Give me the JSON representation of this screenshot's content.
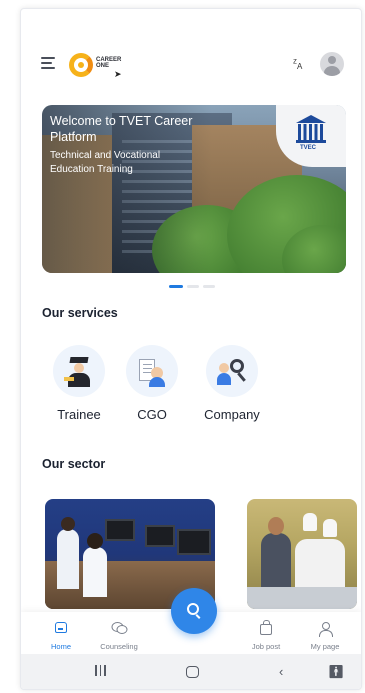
{
  "header": {
    "logo_text": "CAREER ONE",
    "translate_icon": "translate-icon",
    "avatar_icon": "user-avatar-icon"
  },
  "banner": {
    "title": "Welcome to TVET Career Platform",
    "subtitle": "Technical and Vocational Education Training",
    "badge_label": "TVEC",
    "carousel_pages": 3,
    "carousel_active": 1
  },
  "services": {
    "title": "Our services",
    "items": [
      {
        "label": "Trainee",
        "icon": "graduate-icon"
      },
      {
        "label": "CGO",
        "icon": "document-person-icon"
      },
      {
        "label": "Company",
        "icon": "search-people-icon"
      }
    ]
  },
  "sector": {
    "title": "Our sector",
    "cards": [
      {
        "image": "computer-lab-photo"
      },
      {
        "image": "chef-training-photo"
      }
    ]
  },
  "bottom_nav": {
    "items": [
      {
        "label": "Home",
        "icon": "home-icon",
        "active": true
      },
      {
        "label": "Counseling",
        "icon": "chat-icon",
        "active": false
      },
      {
        "label": "Job post",
        "icon": "briefcase-icon",
        "active": false
      },
      {
        "label": "My page",
        "icon": "user-icon",
        "active": false
      }
    ],
    "fab_icon": "search-icon"
  },
  "system_nav": {
    "buttons": [
      "recent-apps-icon",
      "home-icon",
      "back-icon",
      "accessibility-icon"
    ]
  },
  "colors": {
    "primary": "#1f7ae0",
    "accent_logo": "#f6b21a",
    "service_circle": "#eef4fc"
  }
}
